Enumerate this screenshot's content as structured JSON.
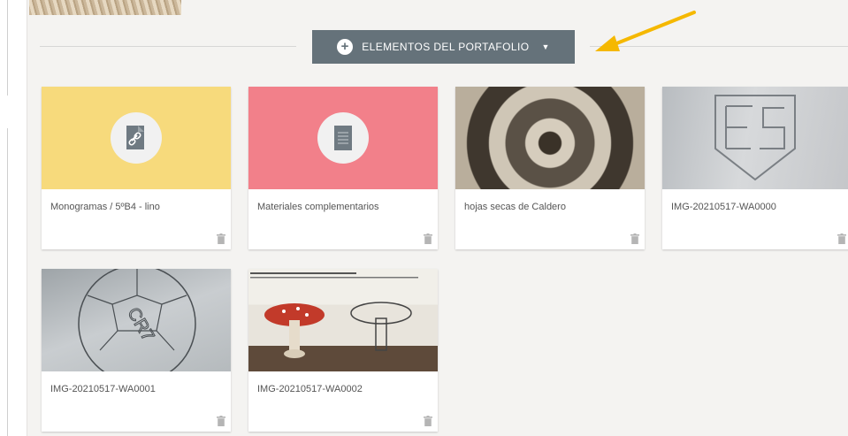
{
  "portfolio": {
    "add_button_label": "ELEMENTOS DEL PORTAFOLIO",
    "add_icon": "plus-circle-icon",
    "caret_icon": "caret-down-icon",
    "accent_color": "#65727a"
  },
  "annotation": {
    "arrow_color": "#f5b800"
  },
  "items": [
    {
      "title": "Monogramas / 5ºB4 - lino",
      "type": "link",
      "color": "#f7da7c",
      "icon": "link-icon"
    },
    {
      "title": "Materiales complementarios",
      "type": "document",
      "color": "#f2808a",
      "icon": "document-icon"
    },
    {
      "title": "hojas secas de Caldero",
      "type": "image"
    },
    {
      "title": "IMG-20210517-WA0000",
      "type": "image"
    },
    {
      "title": "IMG-20210517-WA0001",
      "type": "image"
    },
    {
      "title": "IMG-20210517-WA0002",
      "type": "image"
    }
  ]
}
